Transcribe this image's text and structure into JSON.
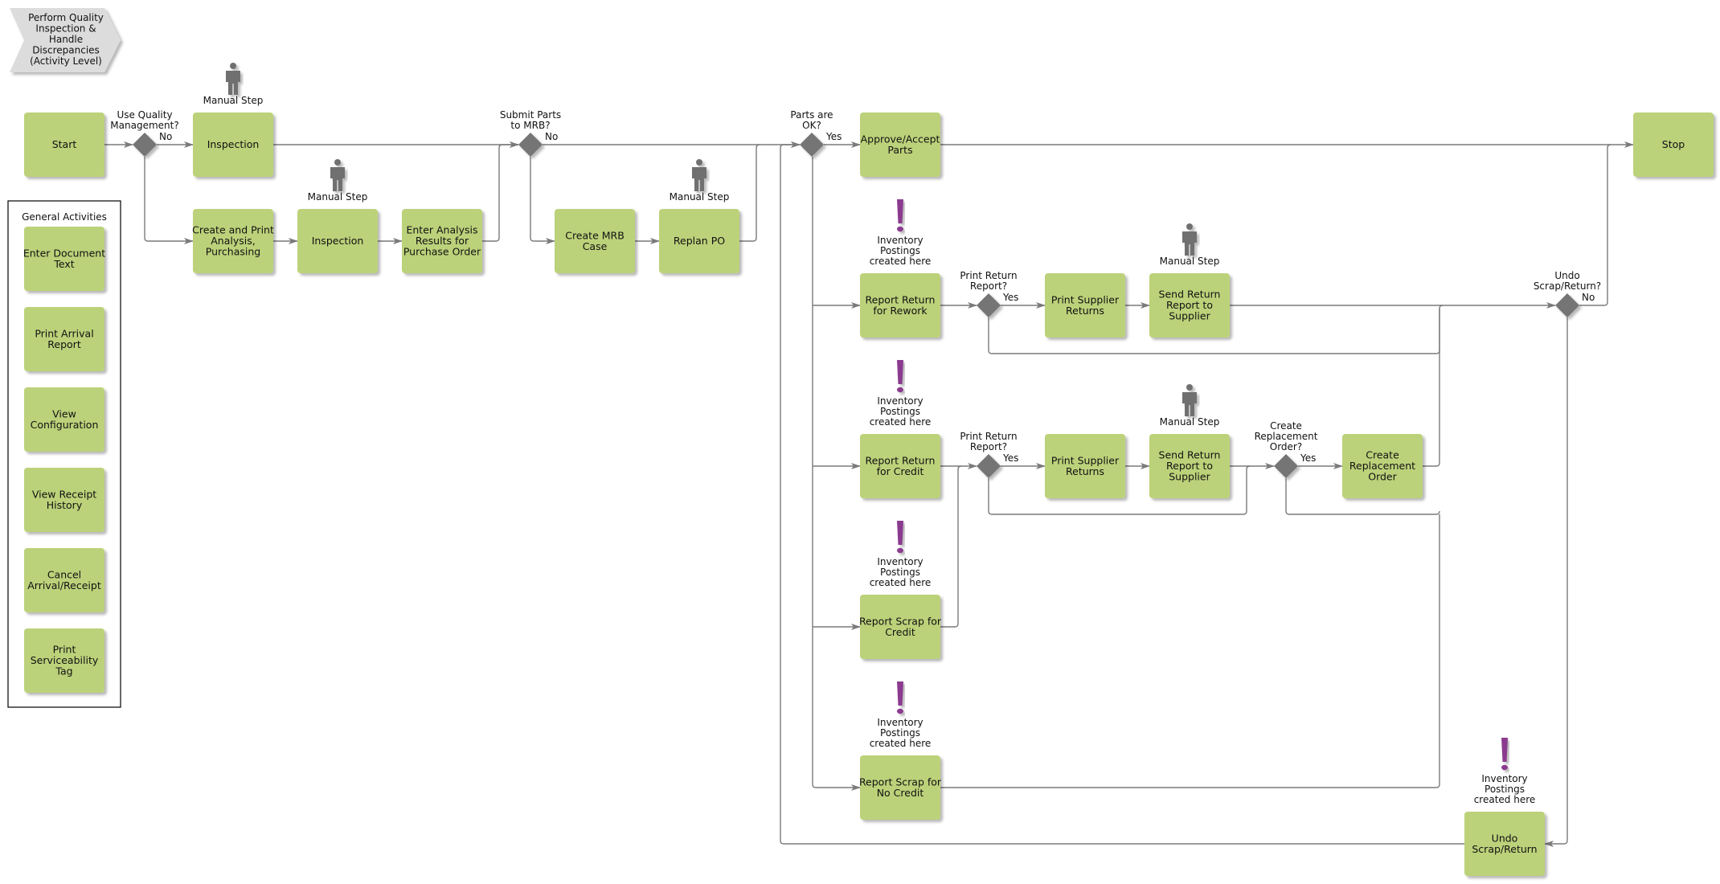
{
  "title": {
    "text": [
      "Perform Quality",
      "Inspection &",
      "Handle",
      "Discrepancies",
      "(Activity Level)"
    ]
  },
  "colors": {
    "box": "#bcd27a",
    "diamond": "#747474",
    "edge": "#7a7a7a",
    "exclaim": "#8b3a8f",
    "person": "#707070",
    "title_bg": "#dcdcdc"
  },
  "general_activities": {
    "heading": "General Activities",
    "items": [
      [
        "Enter Document",
        "Text"
      ],
      [
        "Print Arrival",
        "Report"
      ],
      [
        "View",
        "Configuration"
      ],
      [
        "View Receipt",
        "History"
      ],
      [
        "Cancel",
        "Arrival/Receipt"
      ],
      [
        "Print",
        "Serviceability",
        "Tag"
      ]
    ]
  },
  "nodes": {
    "start": [
      "Start"
    ],
    "inspection1": [
      "Inspection"
    ],
    "create_print": [
      "Create and Print",
      "Analysis,",
      "Purchasing"
    ],
    "inspection2": [
      "Inspection"
    ],
    "enter_analysis": [
      "Enter Analysis",
      "Results for",
      "Purchase Order"
    ],
    "create_mrb": [
      "Create MRB",
      "Case"
    ],
    "replan_po": [
      "Replan PO"
    ],
    "approve": [
      "Approve/Accept",
      "Parts"
    ],
    "stop": [
      "Stop"
    ],
    "return_rework": [
      "Report Return",
      "for Rework"
    ],
    "print_supplier1": [
      "Print Supplier",
      "Returns"
    ],
    "send_return1": [
      "Send Return",
      "Report to",
      "Supplier"
    ],
    "return_credit": [
      "Report Return",
      "for Credit"
    ],
    "print_supplier2": [
      "Print Supplier",
      "Returns"
    ],
    "send_return2": [
      "Send Return",
      "Report to",
      "Supplier"
    ],
    "create_replacement": [
      "Create",
      "Replacement",
      "Order"
    ],
    "scrap_credit": [
      "Report Scrap for",
      "Credit"
    ],
    "scrap_no_credit": [
      "Report Scrap for",
      "No Credit"
    ],
    "undo": [
      "Undo",
      "Scrap/Return"
    ]
  },
  "decisions": {
    "use_qm": {
      "label": [
        "Use Quality",
        "Management?"
      ],
      "branch": "No"
    },
    "submit_mrb": {
      "label": [
        "Submit Parts",
        "to MRB?"
      ],
      "branch": "No"
    },
    "parts_ok": {
      "label": [
        "Parts are",
        "OK?"
      ],
      "branch": "Yes"
    },
    "print_return1": {
      "label": [
        "Print Return",
        "Report?"
      ],
      "branch": "Yes"
    },
    "print_return2": {
      "label": [
        "Print Return",
        "Report?"
      ],
      "branch": "Yes"
    },
    "create_repl": {
      "label": [
        "Create",
        "Replacement",
        "Order?"
      ],
      "branch": "Yes"
    },
    "undo_q": {
      "label": [
        "Undo",
        "Scrap/Return?"
      ],
      "branch": "No"
    }
  },
  "annotations": {
    "manual_step": "Manual Step",
    "inventory": [
      "Inventory",
      "Postings",
      "created here"
    ]
  }
}
